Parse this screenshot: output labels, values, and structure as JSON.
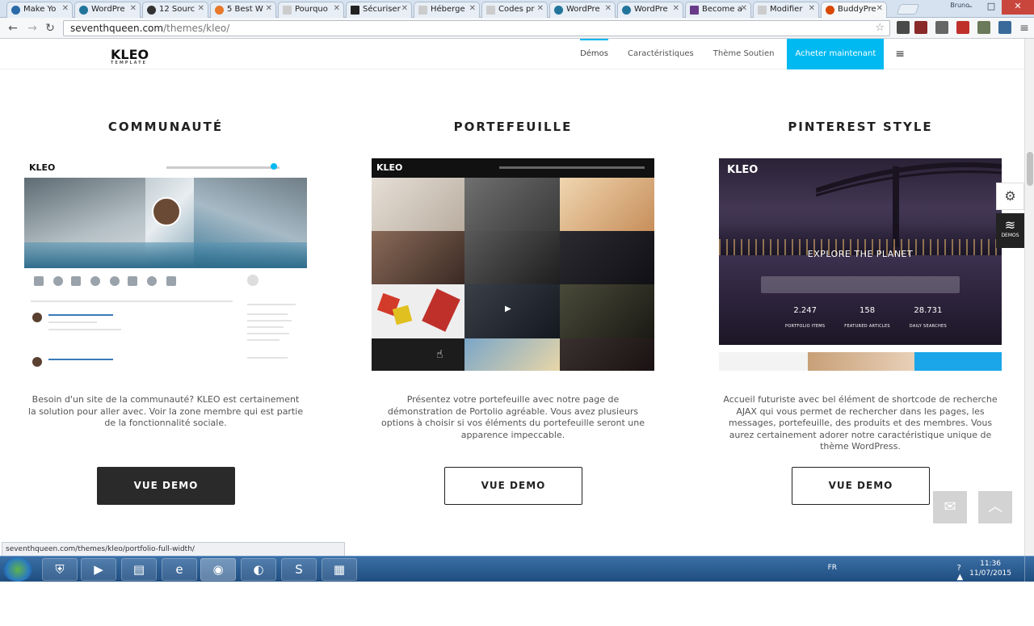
{
  "browser": {
    "tabs": [
      {
        "title": "Make Yo"
      },
      {
        "title": "WordPre"
      },
      {
        "title": "12 Sourc"
      },
      {
        "title": "5 Best W"
      },
      {
        "title": "Pourquo"
      },
      {
        "title": "Sécuriser"
      },
      {
        "title": "Héberge"
      },
      {
        "title": "Codes pr"
      },
      {
        "title": "WordPre"
      },
      {
        "title": "WordPre"
      },
      {
        "title": "Become a"
      },
      {
        "title": "Modifier"
      },
      {
        "title": "BuddyPre"
      }
    ],
    "user": "Bruno",
    "url_host": "seventhqueen.com",
    "url_path": "/themes/kleo/",
    "status_url": "seventhqueen.com/themes/kleo/portfolio-full-width/"
  },
  "site": {
    "logo": "KLEO",
    "logo_sub": "TEMPLATE",
    "menu": {
      "demos": "Démos",
      "features": "Caractéristiques",
      "support": "Thème Soutien",
      "buy": "Acheter maintenant"
    }
  },
  "demos": [
    {
      "title": "COMMUNAUTÉ",
      "description": "Besoin d'un site de la communauté? KLEO est certainement la solution pour aller avec. Voir la zone membre qui est partie de la fonctionnalité sociale.",
      "button": "VUE DEMO",
      "shot_logo": "KLEO"
    },
    {
      "title": "PORTEFEUILLE",
      "description": "Présentez votre portefeuille avec notre page de démonstration de Portolio agréable. Vous avez plusieurs options à choisir si vos éléments du portefeuille seront une apparence impeccable.",
      "button": "VUE DEMO",
      "shot_logo": "KLEO"
    },
    {
      "title": "PINTEREST STYLE",
      "description": "Accueil futuriste avec bel élément de shortcode de recherche AJAX qui vous permet de rechercher dans les pages, les messages, portefeuille, des produits et des membres. Vous aurez certainement adorer notre caractéristique unique de thème WordPress.",
      "button": "VUE DEMO",
      "shot_logo": "KLEO",
      "hero_title": "EXPLORE THE PLANET",
      "stats": [
        {
          "value": "2.247",
          "label": "PORTFOLIO ITEMS"
        },
        {
          "value": "158",
          "label": "FEATURED ARTICLES"
        },
        {
          "value": "28.731",
          "label": "DAILY SEARCHES"
        }
      ]
    }
  ],
  "floating": {
    "demos_label": "DEMOS"
  },
  "taskbar": {
    "lang": "FR",
    "time": "11:36",
    "date": "11/07/2015"
  },
  "colors": {
    "accent": "#00b9f1",
    "dark_button": "#2a2a2a"
  }
}
